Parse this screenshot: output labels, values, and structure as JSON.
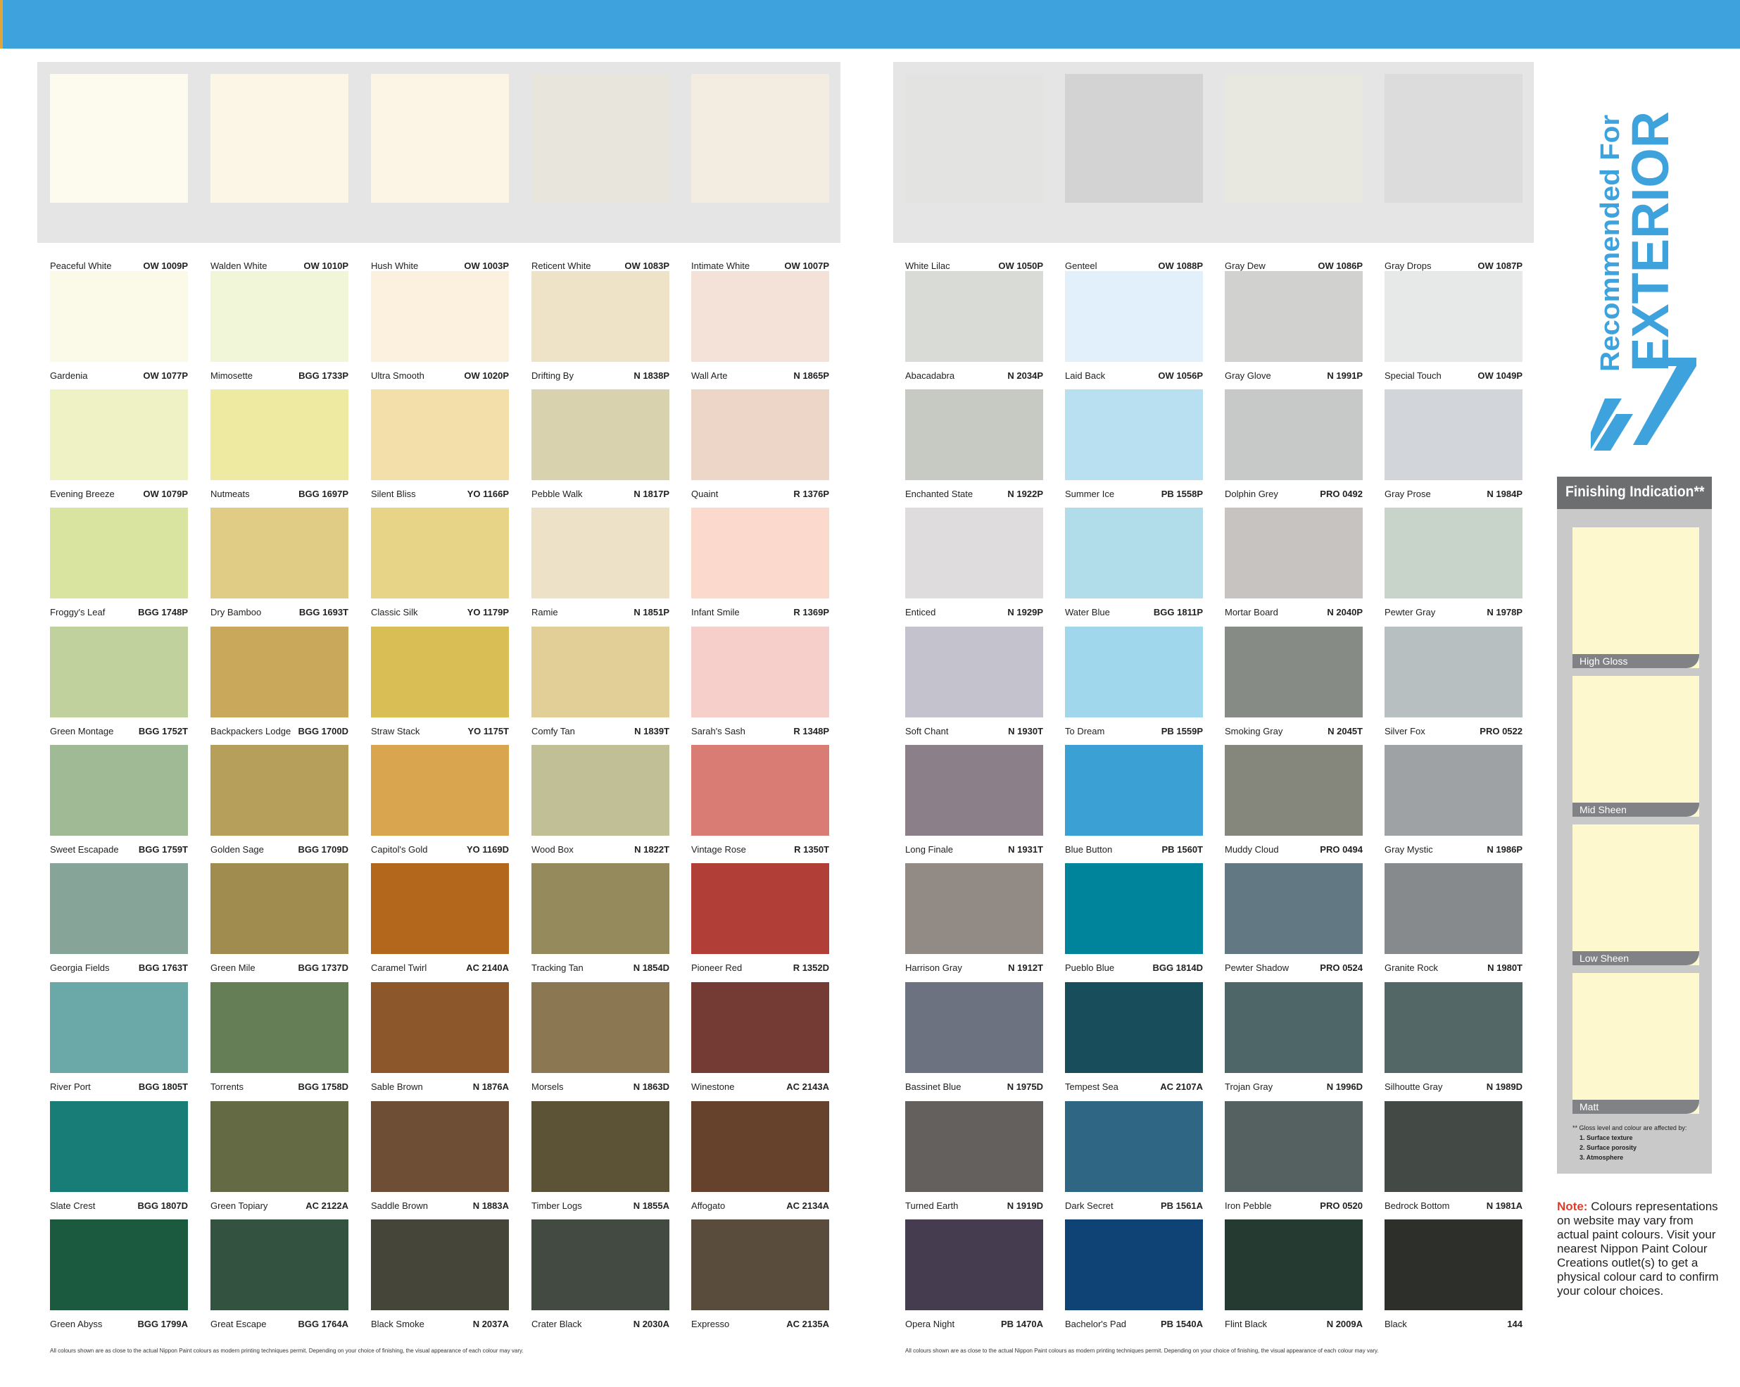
{
  "header": {
    "bar_color": "#3ea2dc"
  },
  "left_panel": {
    "rows": [
      [
        {
          "name": "Peaceful White",
          "code": "OW 1009P",
          "color": "#fdfaee"
        },
        {
          "name": "Walden White",
          "code": "OW 1010P",
          "color": "#fbf6e5"
        },
        {
          "name": "Hush White",
          "code": "OW 1003P",
          "color": "#fcf5e6"
        },
        {
          "name": "Reticent White",
          "code": "OW 1083P",
          "color": "#e8e5dd"
        },
        {
          "name": "Intimate White",
          "code": "OW 1007P",
          "color": "#f2ece1"
        }
      ],
      [
        {
          "name": "Gardenia",
          "code": "OW 1077P",
          "color": "#fbfae8"
        },
        {
          "name": "Mimosette",
          "code": "BGG 1733P",
          "color": "#f2f6d9"
        },
        {
          "name": "Ultra Smooth",
          "code": "OW 1020P",
          "color": "#fcf1df"
        },
        {
          "name": "Drifting By",
          "code": "N 1838P",
          "color": "#efe3c7"
        },
        {
          "name": "Wall Arte",
          "code": "N 1865P",
          "color": "#f4e2d8"
        }
      ],
      [
        {
          "name": "Evening Breeze",
          "code": "OW 1079P",
          "color": "#eef2c4"
        },
        {
          "name": "Nutmeats",
          "code": "BGG 1697P",
          "color": "#efeaa1"
        },
        {
          "name": "Silent Bliss",
          "code": "YO 1166P",
          "color": "#f3dfa9"
        },
        {
          "name": "Pebble Walk",
          "code": "N 1817P",
          "color": "#d9d2ae"
        },
        {
          "name": "Quaint",
          "code": "R 1376P",
          "color": "#edd5c8"
        }
      ],
      [
        {
          "name": "Froggy's Leaf",
          "code": "BGG 1748P",
          "color": "#d9e4a1"
        },
        {
          "name": "Dry Bamboo",
          "code": "BGG 1693T",
          "color": "#e1cc86"
        },
        {
          "name": "Classic Silk",
          "code": "YO 1179P",
          "color": "#e8d487"
        },
        {
          "name": "Ramie",
          "code": "N 1851P",
          "color": "#ede2c8"
        },
        {
          "name": "Infant Smile",
          "code": "R 1369P",
          "color": "#fbd9cc"
        }
      ],
      [
        {
          "name": "Green Montage",
          "code": "BGG 1752T",
          "color": "#c0d19e"
        },
        {
          "name": "Backpackers Lodge",
          "code": "BGG 1700D",
          "color": "#c9a75b"
        },
        {
          "name": "Straw Stack",
          "code": "YO 1175T",
          "color": "#d9bd55"
        },
        {
          "name": "Comfy Tan",
          "code": "N 1839T",
          "color": "#e2cf97"
        },
        {
          "name": "Sarah's Sash",
          "code": "R 1348P",
          "color": "#f7cfca"
        }
      ],
      [
        {
          "name": "Sweet Escapade",
          "code": "BGG 1759T",
          "color": "#9fba95"
        },
        {
          "name": "Golden Sage",
          "code": "BGG 1709D",
          "color": "#b59f5b"
        },
        {
          "name": "Capitol's Gold",
          "code": "YO 1169D",
          "color": "#d9a54f"
        },
        {
          "name": "Wood Box",
          "code": "N 1822T",
          "color": "#c0bf95"
        },
        {
          "name": "Vintage Rose",
          "code": "R 1350T",
          "color": "#d97c73"
        }
      ],
      [
        {
          "name": "Georgia Fields",
          "code": "BGG 1763T",
          "color": "#86a497"
        },
        {
          "name": "Green Mile",
          "code": "BGG 1737D",
          "color": "#a08c4f"
        },
        {
          "name": "Caramel Twirl",
          "code": "AC 2140A",
          "color": "#b3671c"
        },
        {
          "name": "Tracking Tan",
          "code": "N 1854D",
          "color": "#958a5c"
        },
        {
          "name": "Pioneer Red",
          "code": "R 1352D",
          "color": "#b23f37"
        }
      ],
      [
        {
          "name": "River Port",
          "code": "BGG 1805T",
          "color": "#6aa9a8"
        },
        {
          "name": "Torrents",
          "code": "BGG 1758D",
          "color": "#667e55"
        },
        {
          "name": "Sable Brown",
          "code": "N 1876A",
          "color": "#8b572b"
        },
        {
          "name": "Morsels",
          "code": "N 1863D",
          "color": "#8b7751"
        },
        {
          "name": "Winestone",
          "code": "AC 2143A",
          "color": "#743a34"
        }
      ],
      [
        {
          "name": "Slate Crest",
          "code": "BGG 1807D",
          "color": "#187d76"
        },
        {
          "name": "Green Topiary",
          "code": "AC 2122A",
          "color": "#646a44"
        },
        {
          "name": "Saddle Brown",
          "code": "N 1883A",
          "color": "#6e4f36"
        },
        {
          "name": "Timber Logs",
          "code": "N 1855A",
          "color": "#5c5336"
        },
        {
          "name": "Affogato",
          "code": "AC 2134A",
          "color": "#66422d"
        }
      ],
      [
        {
          "name": "Green Abyss",
          "code": "BGG 1799A",
          "color": "#1c5a40"
        },
        {
          "name": "Great Escape",
          "code": "BGG 1764A",
          "color": "#33523f"
        },
        {
          "name": "Black Smoke",
          "code": "N 2037A",
          "color": "#46453a"
        },
        {
          "name": "Crater Black",
          "code": "N 2030A",
          "color": "#434a42"
        },
        {
          "name": "Expresso",
          "code": "AC 2135A",
          "color": "#594c3c"
        }
      ]
    ],
    "disclaimer": "All colours shown are as close to the actual Nippon Paint colours as modern printing techniques permit. Depending on your choice of finishing, the visual appearance of each colour may vary."
  },
  "right_panel": {
    "rows": [
      [
        {
          "name": "White Lilac",
          "code": "OW 1050P",
          "color": "#e3e3e1"
        },
        {
          "name": "Genteel",
          "code": "OW 1088P",
          "color": "#d4d3d4"
        },
        {
          "name": "Gray Dew",
          "code": "OW 1086P",
          "color": "#e8e8e0"
        },
        {
          "name": "Gray Drops",
          "code": "OW 1087P",
          "color": "#dddcdd"
        }
      ],
      [
        {
          "name": "Abacadabra",
          "code": "N 2034P",
          "color": "#d9dbd6"
        },
        {
          "name": "Laid Back",
          "code": "OW 1056P",
          "color": "#e1f0fb"
        },
        {
          "name": "Gray Glove",
          "code": "N 1991P",
          "color": "#d1d2d0"
        },
        {
          "name": "Special Touch",
          "code": "OW 1049P",
          "color": "#e7e8e8"
        }
      ],
      [
        {
          "name": "Enchanted State",
          "code": "N 1922P",
          "color": "#c7c9c3"
        },
        {
          "name": "Summer Ice",
          "code": "PB 1558P",
          "color": "#b9e0f0"
        },
        {
          "name": "Dolphin Grey",
          "code": "PRO 0492",
          "color": "#c7c8c8"
        },
        {
          "name": "Gray Prose",
          "code": "N 1984P",
          "color": "#d2d6db"
        }
      ],
      [
        {
          "name": "Enticed",
          "code": "N 1929P",
          "color": "#dedcdd"
        },
        {
          "name": "Water Blue",
          "code": "BGG 1811P",
          "color": "#b0dde9"
        },
        {
          "name": "Mortar Board",
          "code": "N 2040P",
          "color": "#c6c3c1"
        },
        {
          "name": "Pewter Gray",
          "code": "N 1978P",
          "color": "#c8d3ca"
        }
      ],
      [
        {
          "name": "Soft Chant",
          "code": "N 1930T",
          "color": "#c4c2cc"
        },
        {
          "name": "To Dream",
          "code": "PB 1559P",
          "color": "#a0d7ec"
        },
        {
          "name": "Smoking Gray",
          "code": "N 2045T",
          "color": "#868b85"
        },
        {
          "name": "Silver Fox",
          "code": "PRO 0522",
          "color": "#b7bfc1"
        }
      ],
      [
        {
          "name": "Long Finale",
          "code": "N 1931T",
          "color": "#8b7f8a"
        },
        {
          "name": "Blue Button",
          "code": "PB 1560T",
          "color": "#3ba1d4"
        },
        {
          "name": "Muddy Cloud",
          "code": "PRO 0494",
          "color": "#86877c"
        },
        {
          "name": "Gray Mystic",
          "code": "N 1986P",
          "color": "#9ea2a4"
        }
      ],
      [
        {
          "name": "Harrison Gray",
          "code": "N 1912T",
          "color": "#928a85"
        },
        {
          "name": "Pueblo Blue",
          "code": "BGG 1814D",
          "color": "#00849c"
        },
        {
          "name": "Pewter Shadow",
          "code": "PRO 0524",
          "color": "#627882"
        },
        {
          "name": "Granite Rock",
          "code": "N 1980T",
          "color": "#868a8c"
        }
      ],
      [
        {
          "name": "Bassinet Blue",
          "code": "N 1975D",
          "color": "#6c7280"
        },
        {
          "name": "Tempest Sea",
          "code": "AC 2107A",
          "color": "#184e5c"
        },
        {
          "name": "Trojan Gray",
          "code": "N 1996D",
          "color": "#4f6669"
        },
        {
          "name": "Silhoutte Gray",
          "code": "N 1989D",
          "color": "#546767"
        }
      ],
      [
        {
          "name": "Turned Earth",
          "code": "N 1919D",
          "color": "#63605e"
        },
        {
          "name": "Dark Secret",
          "code": "PB 1561A",
          "color": "#2e6684"
        },
        {
          "name": "Iron Pebble",
          "code": "PRO 0520",
          "color": "#556161"
        },
        {
          "name": "Bedrock Bottom",
          "code": "N 1981A",
          "color": "#434a45"
        }
      ],
      [
        {
          "name": "Opera Night",
          "code": "PB 1470A",
          "color": "#463c4f"
        },
        {
          "name": "Bachelor's Pad",
          "code": "PB 1540A",
          "color": "#0f4376"
        },
        {
          "name": "Flint Black",
          "code": "N 2009A",
          "color": "#253a31"
        },
        {
          "name": "Black",
          "code": "144",
          "color": "#2c2f2a"
        }
      ]
    ],
    "disclaimer": "All colours shown are as close to the actual Nippon Paint colours as modern printing techniques permit. Depending on your choice of finishing, the visual appearance of each colour may vary."
  },
  "recommended": {
    "line1": "Recommended For",
    "line2": "EXTERIOR",
    "color": "#3ea2dc"
  },
  "finishing": {
    "title": "Finishing Indication**",
    "levels": [
      "High Gloss",
      "Mid Sheen",
      "Low Sheen",
      "Matt"
    ],
    "card_color": "#fdf8cd",
    "gloss_note": "** Gloss level and colour are affected by:",
    "gloss_factors": [
      "1. Surface texture",
      "2. Surface porosity",
      "3. Atmosphere"
    ]
  },
  "note": {
    "label": "Note:",
    "text": "Colours representations on website may vary from actual paint colours. Visit your nearest Nippon Paint Colour Creations outlet(s) to get a physical colour card to confirm your colour choices."
  }
}
